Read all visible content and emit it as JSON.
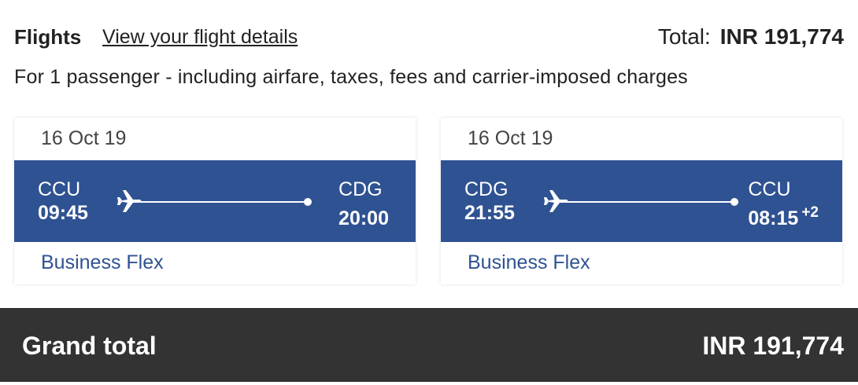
{
  "header": {
    "title": "Flights",
    "details_link": "View your flight details",
    "total_label": "Total:",
    "total_value": "INR 191,774"
  },
  "subtitle": "For 1 passenger - including airfare, taxes, fees and carrier-imposed charges",
  "flights": [
    {
      "date": "16 Oct 19",
      "origin_code": "CCU",
      "origin_time": "09:45",
      "dest_code": "CDG",
      "dest_time": "20:00",
      "day_offset": "",
      "fare": "Business Flex",
      "icon": "plane-icon"
    },
    {
      "date": "16 Oct 19",
      "origin_code": "CDG",
      "origin_time": "21:55",
      "dest_code": "CCU",
      "dest_time": "08:15",
      "day_offset": "+2",
      "fare": "Business Flex",
      "icon": "plane-icon"
    }
  ],
  "grand_total": {
    "label": "Grand total",
    "value": "INR 191,774"
  },
  "colors": {
    "band": "#2f5292",
    "fare_text": "#2f5292",
    "grand_bar": "#333333"
  }
}
